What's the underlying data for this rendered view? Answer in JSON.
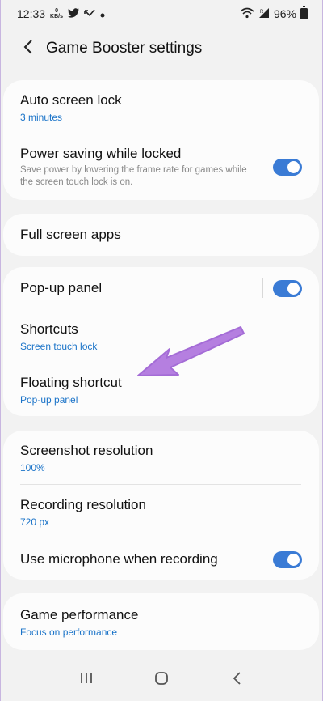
{
  "status": {
    "time": "12:33",
    "kbs_value": "0",
    "kbs_unit": "KB/s",
    "battery": "96%"
  },
  "header": {
    "title": "Game Booster settings"
  },
  "sections": {
    "auto_lock": {
      "title": "Auto screen lock",
      "value": "3 minutes"
    },
    "power_saving": {
      "title": "Power saving while locked",
      "description": "Save power by lowering the frame rate for games while the screen touch lock is on.",
      "enabled": true
    },
    "full_screen": {
      "title": "Full screen apps"
    },
    "popup_panel": {
      "title": "Pop-up panel",
      "enabled": true
    },
    "shortcuts": {
      "title": "Shortcuts",
      "value": "Screen touch lock"
    },
    "floating_shortcut": {
      "title": "Floating shortcut",
      "value": "Pop-up panel"
    },
    "screenshot_res": {
      "title": "Screenshot resolution",
      "value": "100%"
    },
    "recording_res": {
      "title": "Recording resolution",
      "value": "720 px"
    },
    "microphone": {
      "title": "Use microphone when recording",
      "enabled": true
    },
    "performance": {
      "title": "Game performance",
      "value": "Focus on performance"
    }
  },
  "icons": {
    "back": "chevron-left-icon",
    "recent_apps": "recent-apps-icon",
    "home": "home-icon",
    "nav_back": "nav-back-icon"
  },
  "colors": {
    "accent": "#3a7bd5",
    "link_text": "#1a73c8",
    "annotation_arrow": "#b57fe0"
  }
}
